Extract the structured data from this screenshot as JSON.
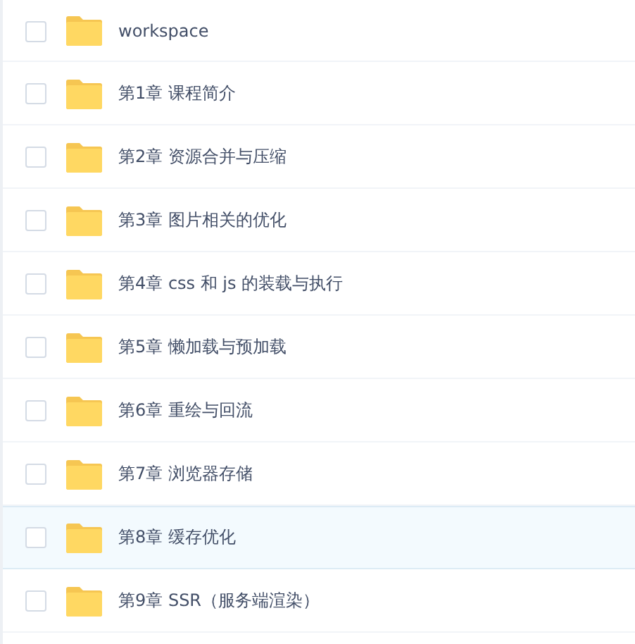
{
  "files": [
    {
      "name": "workspace",
      "checked": false,
      "selected": false
    },
    {
      "name": "第1章 课程简介",
      "checked": false,
      "selected": false
    },
    {
      "name": "第2章 资源合并与压缩",
      "checked": false,
      "selected": false
    },
    {
      "name": "第3章 图片相关的优化",
      "checked": false,
      "selected": false
    },
    {
      "name": "第4章 css 和 js 的装载与执行",
      "checked": false,
      "selected": false
    },
    {
      "name": "第5章 懒加载与预加载",
      "checked": false,
      "selected": false
    },
    {
      "name": "第6章 重绘与回流",
      "checked": false,
      "selected": false
    },
    {
      "name": "第7章 浏览器存储",
      "checked": false,
      "selected": false
    },
    {
      "name": "第8章 缓存优化",
      "checked": false,
      "selected": true
    },
    {
      "name": "第9章 SSR（服务端渲染）",
      "checked": false,
      "selected": false
    }
  ]
}
